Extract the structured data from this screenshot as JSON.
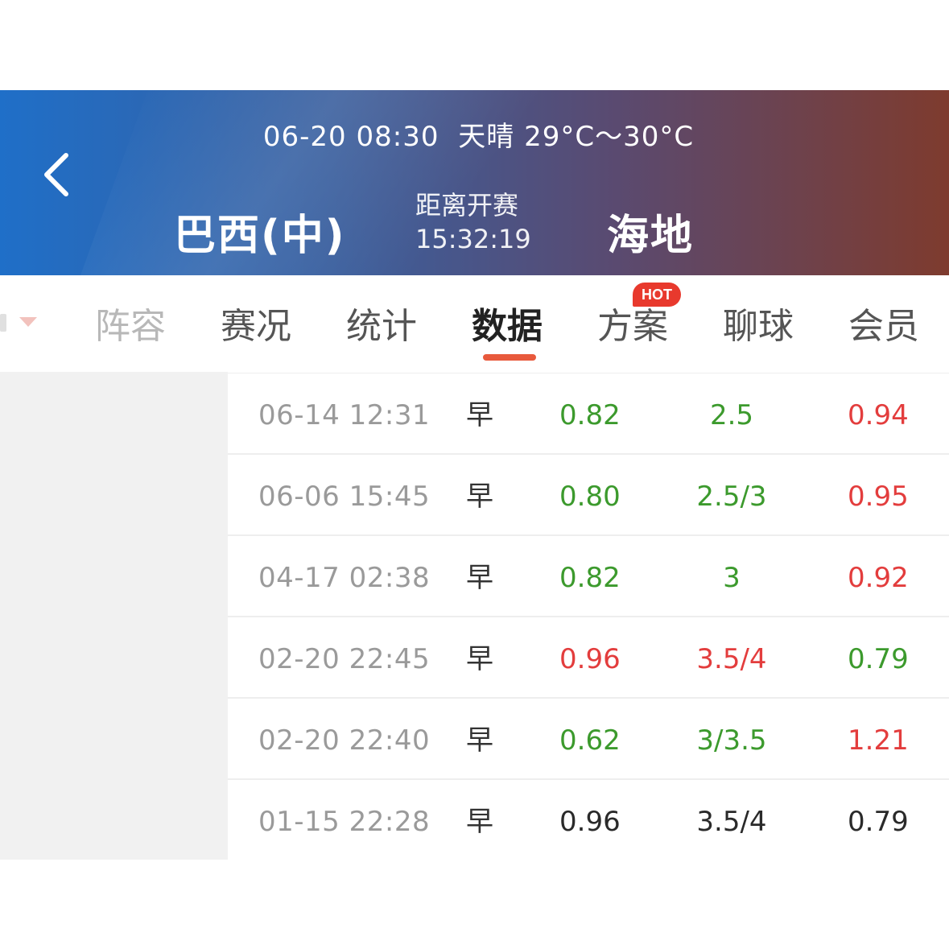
{
  "header": {
    "datetime": "06-20 08:30",
    "weather": "天晴 29°C～30°C",
    "home_team": "巴西(中)",
    "countdown_label": "距离开赛",
    "countdown_time": "15:32:19",
    "away_team": "海地"
  },
  "tabs": [
    {
      "label": "阵容",
      "state": "faded"
    },
    {
      "label": "赛况",
      "state": "normal"
    },
    {
      "label": "统计",
      "state": "normal"
    },
    {
      "label": "数据",
      "state": "active"
    },
    {
      "label": "方案",
      "state": "normal",
      "badge": "HOT"
    },
    {
      "label": "聊球",
      "state": "normal"
    },
    {
      "label": "会员",
      "state": "normal"
    }
  ],
  "rows": [
    {
      "time": "06-14 12:31",
      "type": "早",
      "home": "0.82",
      "line": "2.5",
      "away": "0.94",
      "home_color": "green",
      "line_color": "green",
      "away_color": "red"
    },
    {
      "time": "06-06 15:45",
      "type": "早",
      "home": "0.80",
      "line": "2.5/3",
      "away": "0.95",
      "home_color": "green",
      "line_color": "green",
      "away_color": "red"
    },
    {
      "time": "04-17 02:38",
      "type": "早",
      "home": "0.82",
      "line": "3",
      "away": "0.92",
      "home_color": "green",
      "line_color": "green",
      "away_color": "red"
    },
    {
      "time": "02-20 22:45",
      "type": "早",
      "home": "0.96",
      "line": "3.5/4",
      "away": "0.79",
      "home_color": "red",
      "line_color": "red",
      "away_color": "green"
    },
    {
      "time": "02-20 22:40",
      "type": "早",
      "home": "0.62",
      "line": "3/3.5",
      "away": "1.21",
      "home_color": "green",
      "line_color": "green",
      "away_color": "red"
    },
    {
      "time": "01-15 22:28",
      "type": "早",
      "home": "0.96",
      "line": "3.5/4",
      "away": "0.79",
      "home_color": "black",
      "line_color": "black",
      "away_color": "black"
    }
  ],
  "colors": {
    "green": "#3c9a2d",
    "red": "#e33d3d",
    "accent": "#e8593c",
    "hot_badge": "#e8392d"
  }
}
